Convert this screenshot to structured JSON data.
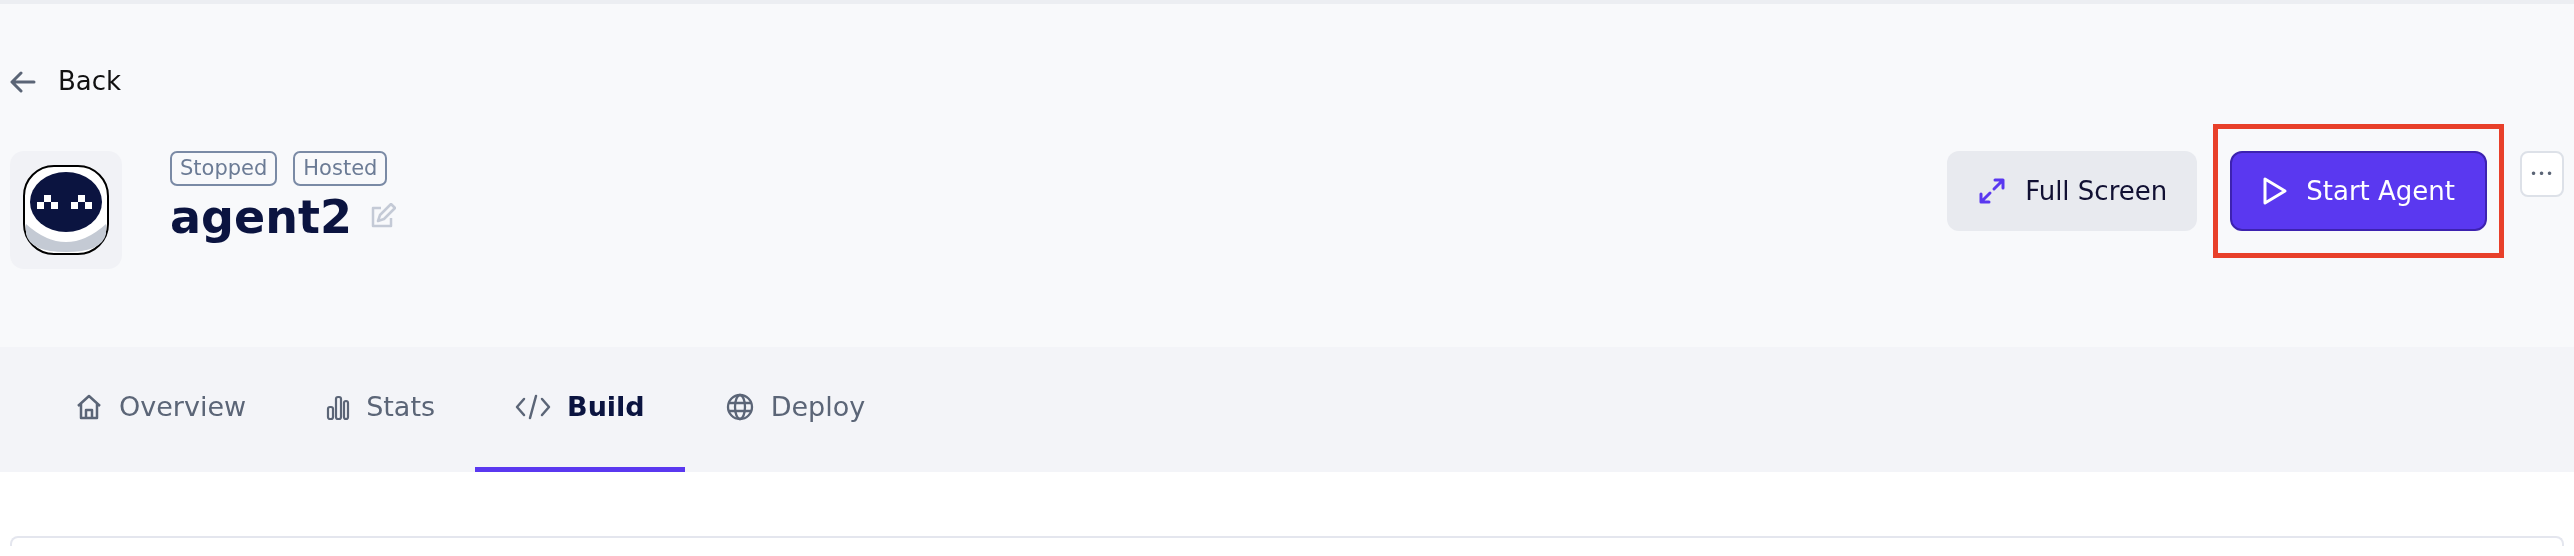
{
  "back": {
    "label": "Back"
  },
  "agent": {
    "name": "agent2",
    "badges": [
      "Stopped",
      "Hosted"
    ]
  },
  "actions": [
    {
      "kind": "secondary",
      "label": "Full Screen",
      "highlighted": false
    },
    {
      "kind": "primary",
      "label": "Start Agent",
      "highlighted": true
    },
    {
      "kind": "more",
      "label": "•••",
      "highlighted": false
    }
  ],
  "tabs": [
    {
      "label": "Overview",
      "kind": "home",
      "selected": false
    },
    {
      "label": "Stats",
      "kind": "stats",
      "selected": false
    },
    {
      "label": "Build",
      "kind": "code",
      "selected": true
    },
    {
      "label": "Deploy",
      "kind": "web",
      "selected": false
    }
  ]
}
